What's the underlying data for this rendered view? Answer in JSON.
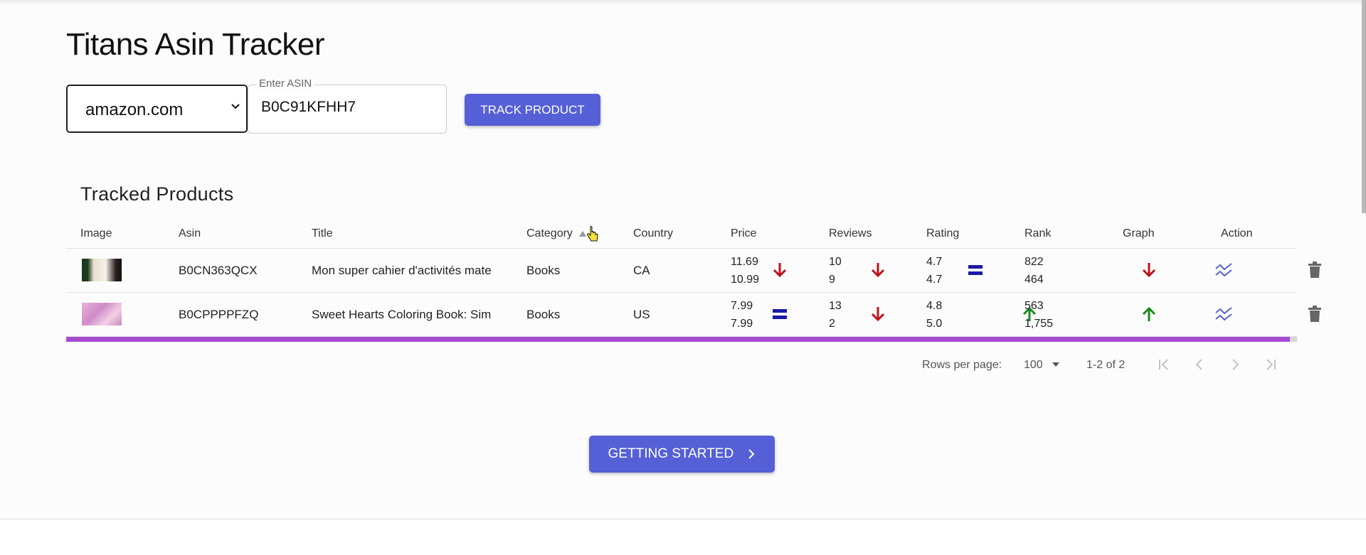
{
  "app": {
    "title": "Titans Asin Tracker"
  },
  "form": {
    "marketplace": "amazon.com",
    "asin_label": "Enter ASIN",
    "asin_value": "B0C91KFHH7",
    "track_label": "TRACK PRODUCT"
  },
  "section_title": "Tracked Products",
  "table": {
    "headers": [
      "Image",
      "Asin",
      "Title",
      "Category",
      "Country",
      "Price",
      "Reviews",
      "Rating",
      "Rank",
      "Graph",
      "Action"
    ],
    "sort": {
      "column": "Category",
      "direction": "ascending"
    },
    "rows": [
      {
        "asin": "B0CN363QCX",
        "title": "Mon super cahier d'activités mate",
        "category": "Books",
        "country": "CA",
        "price": [
          "11.69",
          "10.99"
        ],
        "price_trend": "down",
        "reviews": [
          "10",
          "9"
        ],
        "reviews_trend": "down",
        "rating": [
          "4.7",
          "4.7"
        ],
        "rating_trend": "equal",
        "rank": [
          "822",
          "464"
        ],
        "rank_trend": "down"
      },
      {
        "asin": "B0CPPPPFZQ",
        "title": "Sweet Hearts Coloring Book: Sim",
        "category": "Books",
        "country": "US",
        "price": [
          "7.99",
          "7.99"
        ],
        "price_trend": "equal",
        "reviews": [
          "13",
          "2"
        ],
        "reviews_trend": "down",
        "rating": [
          "4.8",
          "5.0"
        ],
        "rating_trend": "up",
        "rank": [
          "563",
          "1,755"
        ],
        "rank_trend": "up"
      }
    ]
  },
  "pagination": {
    "rows_per_page_label": "Rows per page:",
    "rows_per_page": "100",
    "range": "1-2 of 2"
  },
  "getting_started_label": "GETTING STARTED",
  "colors": {
    "accent": "#5560d6",
    "trend_down": "#c0121c",
    "trend_up": "#1a8a1a",
    "trend_equal": "#1a1aa6",
    "scroll_thumb": "#a64ad0"
  }
}
